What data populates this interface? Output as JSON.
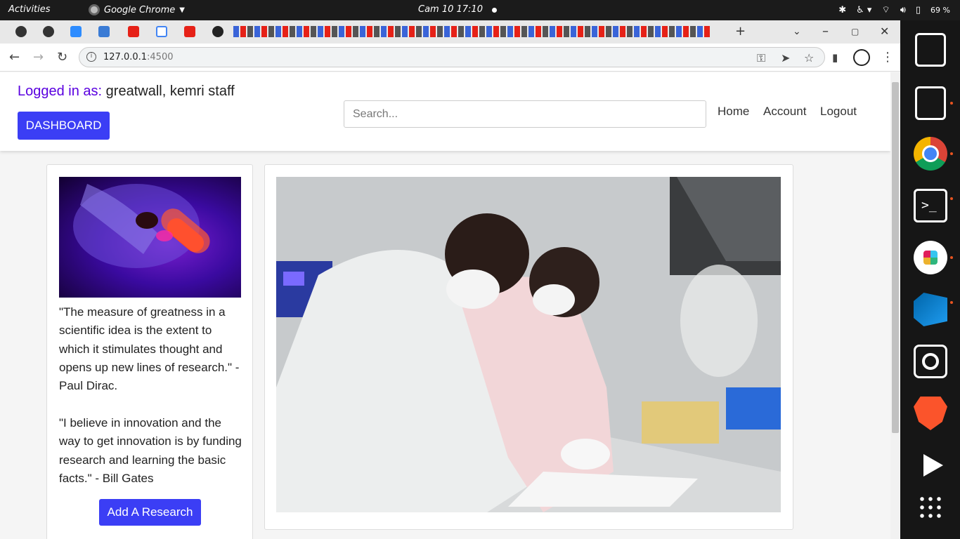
{
  "system": {
    "activities": "Activities",
    "app_name": "Google Chrome",
    "clock": "Cam 10  17:10",
    "battery": "69 %"
  },
  "browser": {
    "url_host": "127.0.0.1",
    "url_port": ":4500"
  },
  "header": {
    "logged_label": "Logged in as:",
    "logged_user": "greatwall, kemri staff",
    "dashboard_button": "DASHBOARD",
    "search_placeholder": "Search...",
    "nav": [
      "Home",
      "Account",
      "Logout"
    ]
  },
  "sidebar": {
    "quote1": "\"The measure of greatness in a scientific idea is the extent to which it stimulates thought and opens up new lines of research.\" - Paul Dirac.",
    "quote2": "\"I believe in innovation and the way to get innovation is by funding research and learning the basic facts.\" - Bill Gates",
    "add_button": "Add A Research"
  },
  "colors": {
    "accent": "#3b3ef5",
    "logged_label": "#5a00e0"
  },
  "icons": {
    "dock": [
      "text-editor-icon",
      "file-cabinet-icon",
      "chrome-icon",
      "terminal-icon",
      "slack-icon",
      "vscode-icon",
      "obs-icon",
      "brave-icon",
      "video-player-icon",
      "app-grid-icon"
    ]
  }
}
